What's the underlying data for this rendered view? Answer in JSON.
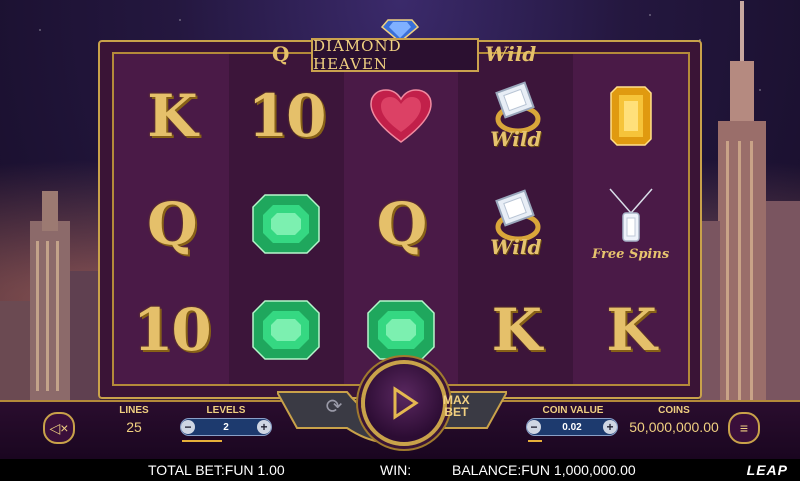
{
  "game": {
    "title": "DIAMOND HEAVEN",
    "provider_logo": "LEAP"
  },
  "reels": [
    [
      "K",
      "Q",
      "10"
    ],
    [
      "10",
      "emerald",
      "emerald"
    ],
    [
      "ruby-heart",
      "Q",
      "emerald"
    ],
    [
      "wild-ring",
      "wild-ring",
      "K"
    ],
    [
      "topaz",
      "free-spins-necklace",
      "K"
    ]
  ],
  "top_peek": {
    "reel1": "Q",
    "reel4": "Wild"
  },
  "symbol_text": {
    "wild": "Wild",
    "free_spins": "Free Spins"
  },
  "controls": {
    "lines_label": "LINES",
    "lines_value": "25",
    "levels_label": "LEVELS",
    "levels_value": "2",
    "coin_value_label": "COIN VALUE",
    "coin_value": "0.02",
    "coins_label": "COINS",
    "coins_value": "50,000,000.00",
    "max_bet_line1": "MAX",
    "max_bet_line2": "BET",
    "minus": "−",
    "plus": "+"
  },
  "status": {
    "total_bet": "TOTAL BET:FUN 1.00",
    "win": "WIN:",
    "balance": "BALANCE:FUN 1,000,000.00"
  },
  "colors": {
    "gold": "#e5c06a",
    "reel_bg": "#4a1a47",
    "emerald": "#2fd07a",
    "ruby": "#c2204a",
    "topaz": "#f0b020"
  }
}
